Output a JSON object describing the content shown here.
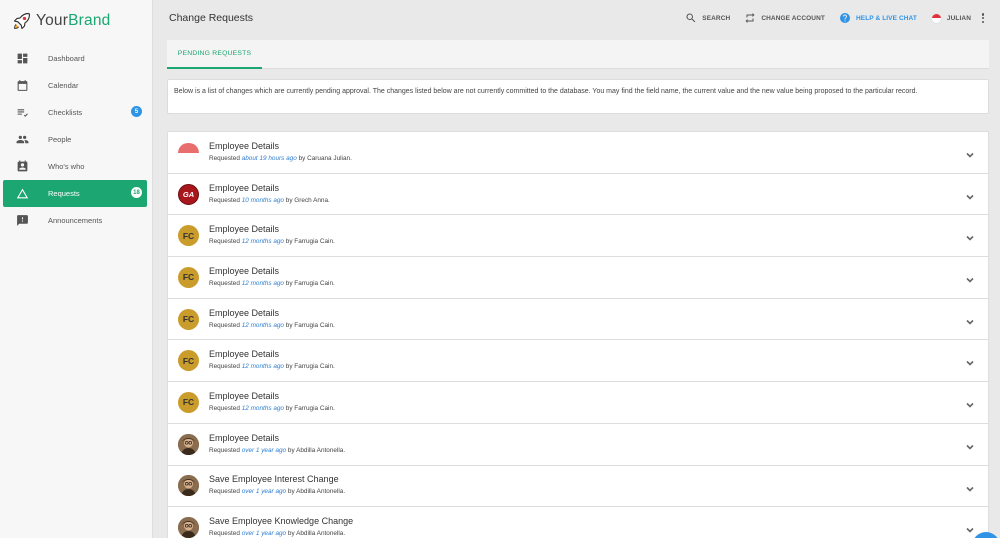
{
  "brand": {
    "prefix": "Your",
    "accent": "Brand"
  },
  "sidebar": {
    "items": [
      {
        "label": "Dashboard",
        "icon": "dashboard-icon"
      },
      {
        "label": "Calendar",
        "icon": "calendar-icon"
      },
      {
        "label": "Checklists",
        "icon": "checklist-icon",
        "badge": "5"
      },
      {
        "label": "People",
        "icon": "people-icon"
      },
      {
        "label": "Who's who",
        "icon": "contact-card-icon"
      },
      {
        "label": "Requests",
        "icon": "triangle-icon",
        "badge": "18",
        "active": true
      },
      {
        "label": "Announcements",
        "icon": "feedback-icon"
      }
    ]
  },
  "header": {
    "title": "Change Requests",
    "search_label": "SEARCH",
    "change_account_label": "CHANGE ACCOUNT",
    "help_label": "HELP & LIVE CHAT",
    "user_label": "JULIAN"
  },
  "tabs": [
    {
      "label": "PENDING REQUESTS",
      "active": true
    }
  ],
  "info_text": "Below is a list of changes which are currently pending approval. The changes listed below are not currently committed to the database. You may find the field name, the current value and the new value being proposed to the particular record.",
  "requests": [
    {
      "title": "Employee Details",
      "prefix": "Requested",
      "ago": "about 19 hours ago",
      "by": "by Caruana Julian.",
      "avatar": "flag"
    },
    {
      "title": "Employee Details",
      "prefix": "Requested",
      "ago": "10 months ago",
      "by": "by Grech Anna.",
      "avatar": "GA"
    },
    {
      "title": "Employee Details",
      "prefix": "Requested",
      "ago": "12 months ago",
      "by": "by Farrugia Cain.",
      "avatar": "FC"
    },
    {
      "title": "Employee Details",
      "prefix": "Requested",
      "ago": "12 months ago",
      "by": "by Farrugia Cain.",
      "avatar": "FC"
    },
    {
      "title": "Employee Details",
      "prefix": "Requested",
      "ago": "12 months ago",
      "by": "by Farrugia Cain.",
      "avatar": "FC"
    },
    {
      "title": "Employee Details",
      "prefix": "Requested",
      "ago": "12 months ago",
      "by": "by Farrugia Cain.",
      "avatar": "FC"
    },
    {
      "title": "Employee Details",
      "prefix": "Requested",
      "ago": "12 months ago",
      "by": "by Farrugia Cain.",
      "avatar": "FC"
    },
    {
      "title": "Employee Details",
      "prefix": "Requested",
      "ago": "over 1 year ago",
      "by": "by Abdilla Antonella.",
      "avatar": "photo"
    },
    {
      "title": "Save Employee Interest Change",
      "prefix": "Requested",
      "ago": "over 1 year ago",
      "by": "by Abdilla Antonella.",
      "avatar": "photo"
    },
    {
      "title": "Save Employee Knowledge Change",
      "prefix": "Requested",
      "ago": "over 1 year ago",
      "by": "by Abdilla Antonella.",
      "avatar": "photo"
    }
  ],
  "colors": {
    "accent": "#1ba672",
    "link": "#2f7fd0",
    "badge": "#2f93e6",
    "fc_avatar": "#c99c2c"
  }
}
